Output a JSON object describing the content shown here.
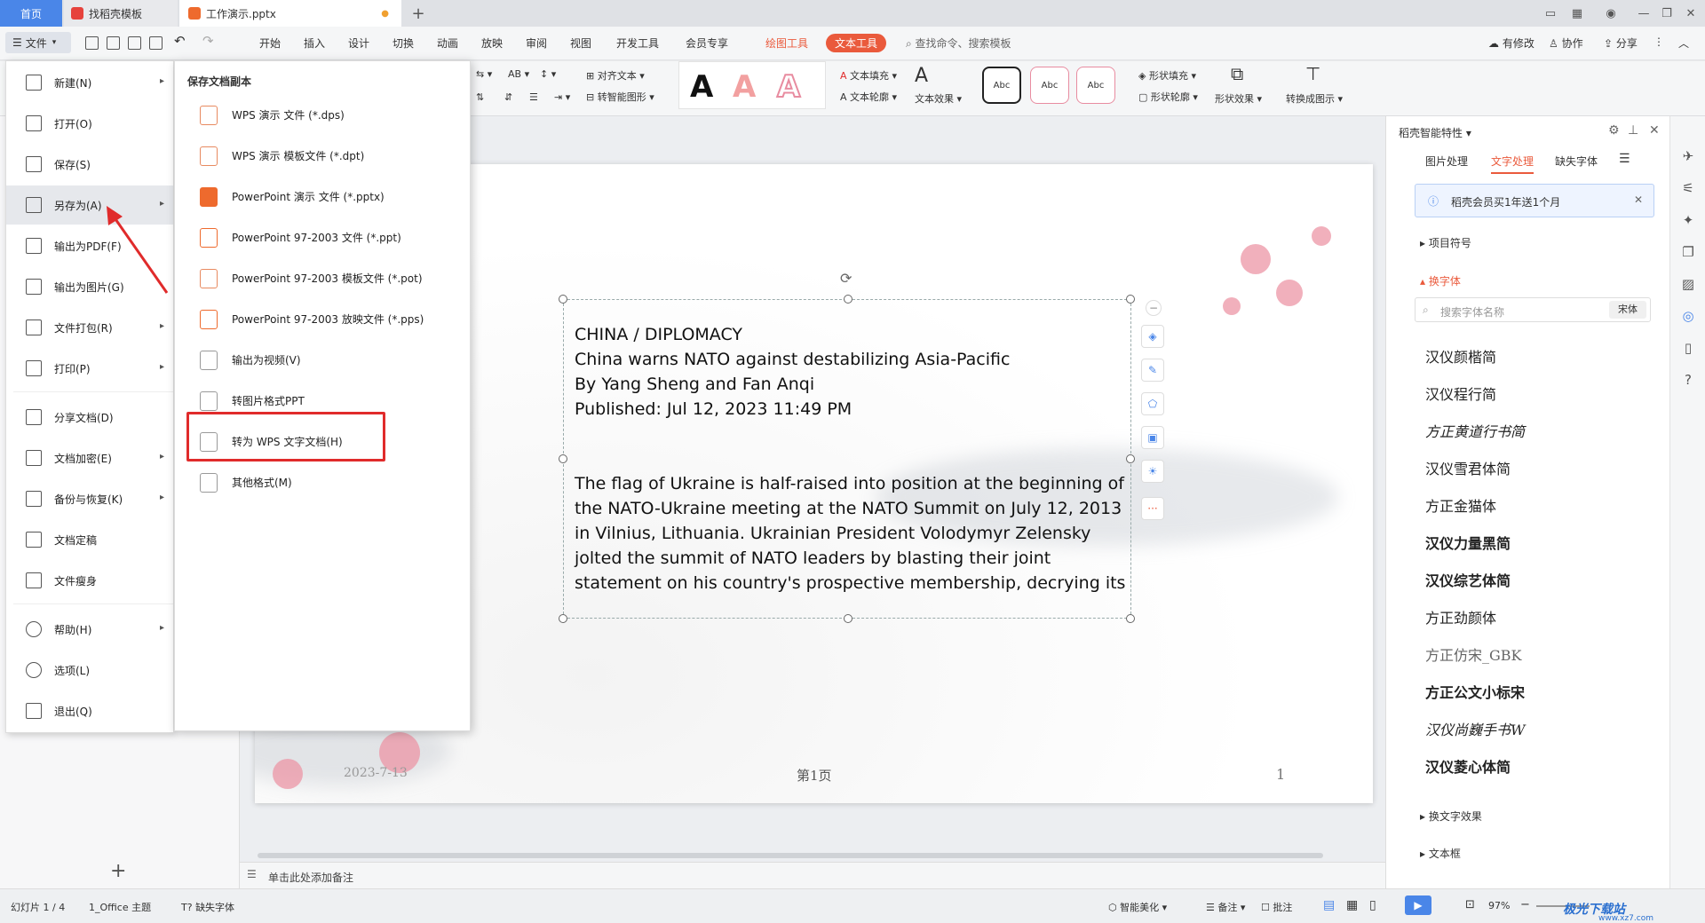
{
  "titlebar": {
    "tabs": [
      {
        "label": "首页"
      },
      {
        "label": "找稻壳模板"
      },
      {
        "label": "工作演示.pptx"
      }
    ],
    "new_tab": "+"
  },
  "menubar": {
    "file": "文件",
    "items": [
      "开始",
      "插入",
      "设计",
      "切换",
      "动画",
      "放映",
      "审阅",
      "视图",
      "开发工具",
      "会员专享"
    ],
    "drawing_tool": "绘图工具",
    "text_tool": "文本工具",
    "search_placeholder": "查找命令、搜索模板",
    "right": {
      "modified": "有修改",
      "collab": "协作",
      "share": "分享"
    }
  },
  "ribbon": {
    "align_text": "对齐文本",
    "smart_shape": "转智能图形",
    "text_fill": "文本填充",
    "text_outline": "文本轮廓",
    "text_effect": "文本效果",
    "abc": "Abc",
    "shape_fill": "形状填充",
    "shape_outline": "形状轮廓",
    "shape_effect": "形状效果",
    "convert_graphic": "转换成图示"
  },
  "file_menu": {
    "items": [
      {
        "label": "新建(N)",
        "arrow": true
      },
      {
        "label": "打开(O)",
        "arrow": false
      },
      {
        "label": "保存(S)",
        "arrow": false
      },
      {
        "label": "另存为(A)",
        "arrow": true
      },
      {
        "label": "输出为PDF(F)",
        "arrow": false
      },
      {
        "label": "输出为图片(G)",
        "arrow": false
      },
      {
        "label": "文件打包(R)",
        "arrow": true
      },
      {
        "label": "打印(P)",
        "arrow": true
      },
      {
        "label": "分享文档(D)",
        "arrow": false
      },
      {
        "label": "文档加密(E)",
        "arrow": true
      },
      {
        "label": "备份与恢复(K)",
        "arrow": true
      },
      {
        "label": "文档定稿",
        "arrow": false
      },
      {
        "label": "文件瘦身",
        "arrow": false
      },
      {
        "label": "帮助(H)",
        "arrow": true
      },
      {
        "label": "选项(L)",
        "arrow": false
      },
      {
        "label": "退出(Q)",
        "arrow": false
      }
    ]
  },
  "save_submenu": {
    "title": "保存文档副本",
    "items": [
      "WPS 演示 文件 (*.dps)",
      "WPS 演示 模板文件 (*.dpt)",
      "PowerPoint 演示 文件 (*.pptx)",
      "PowerPoint 97-2003 文件 (*.ppt)",
      "PowerPoint 97-2003 模板文件 (*.pot)",
      "PowerPoint 97-2003 放映文件 (*.pps)",
      "输出为视频(V)",
      "转图片格式PPT",
      "转为 WPS 文字文档(H)",
      "其他格式(M)"
    ]
  },
  "slide": {
    "lines": [
      "CHINA / DIPLOMACY",
      "China warns NATO against destabilizing Asia-Pacific",
      "By Yang Sheng and Fan Anqi",
      "Published: Jul 12, 2023 11:49 PM",
      "The flag of Ukraine is half-raised into position at the beginning of",
      "the NATO-Ukraine meeting at the NATO Summit on July 12, 2013",
      "in Vilnius, Lithuania. Ukrainian President Volodymyr Zelensky",
      "jolted the summit of NATO leaders by blasting their joint",
      "statement on his country's prospective membership, decrying its"
    ],
    "footer_date": "2023-7-13",
    "footer_page": "第1页",
    "footer_num": "1"
  },
  "right_panel": {
    "header": "稻壳智能特性",
    "tabs": [
      "图片处理",
      "文字处理",
      "缺失字体"
    ],
    "banner": "稻壳会员买1年送1个月",
    "section_bullet": "项目符号",
    "section_font": "换字体",
    "search_placeholder": "搜索字体名称",
    "font_tag": "宋体",
    "fonts": [
      "汉仪颜楷简",
      "汉仪程行简",
      "方正黄道行书简",
      "汉仪雪君体简",
      "方正金猫体",
      "汉仪力量黑简",
      "汉仪综艺体简",
      "方正劲颜体",
      "方正仿宋_GBK",
      "方正公文小标宋",
      "汉仪尚巍手书W",
      "汉仪菱心体简"
    ],
    "section_effect": "换文字效果",
    "section_textbox": "文本框"
  },
  "notes": {
    "placeholder": "单击此处添加备注"
  },
  "statusbar": {
    "slide": "幻灯片 1 / 4",
    "theme": "1_Office 主题",
    "missing_font": "缺失字体",
    "beautify": "智能美化",
    "notes": "备注",
    "comment": "批注",
    "zoom": "97%"
  },
  "watermark": "极光下载站",
  "watermark_url": "www.xz7.com",
  "colors": {
    "accent": "#4a86e8",
    "highlight": "#ea5a3c",
    "red_annotation": "#e02b2b"
  }
}
